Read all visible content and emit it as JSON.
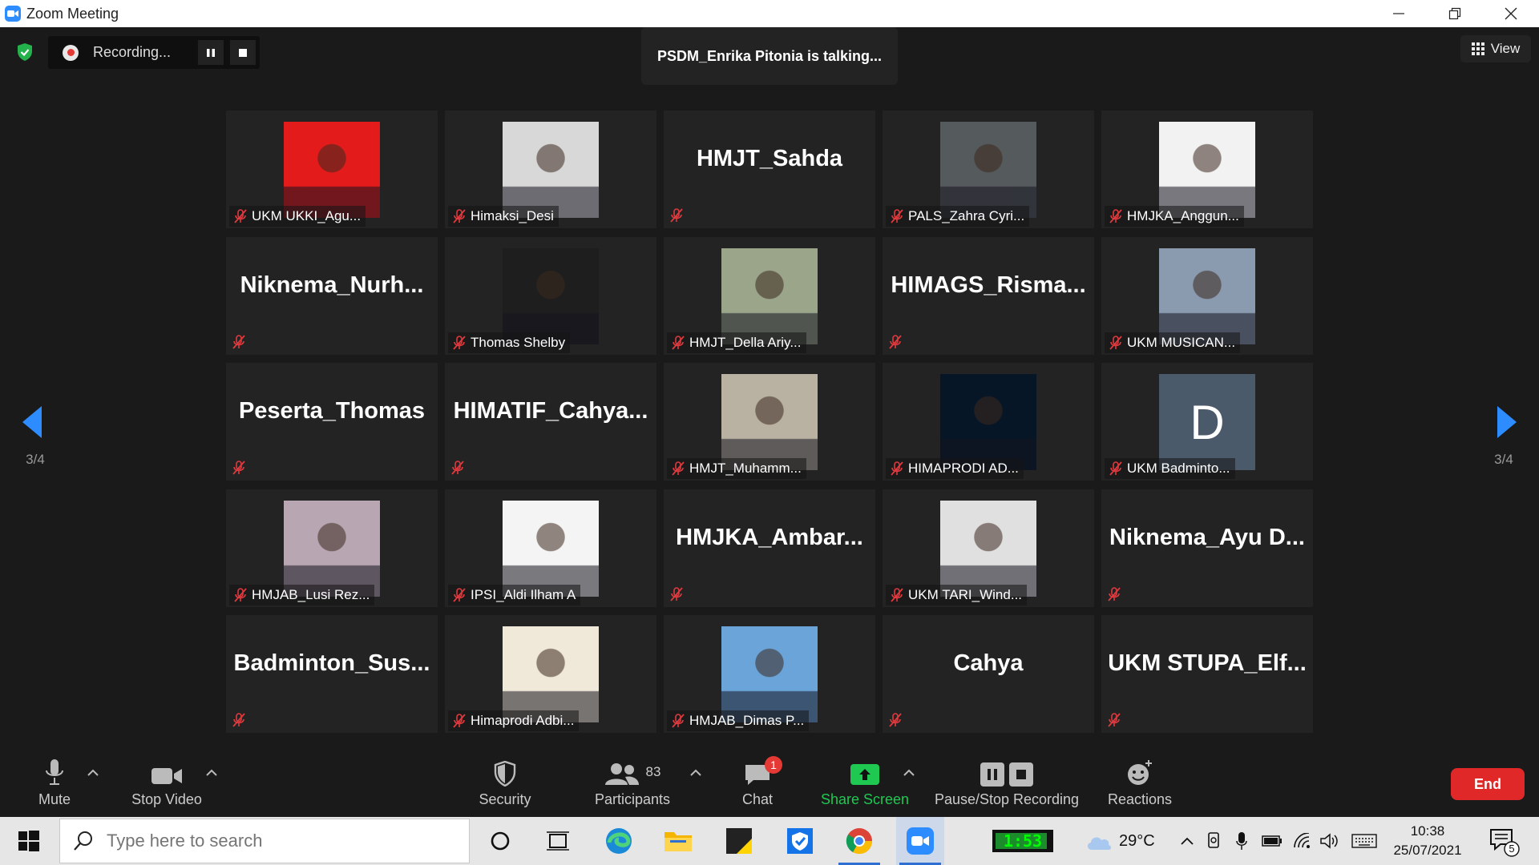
{
  "window": {
    "title": "Zoom Meeting"
  },
  "recording": {
    "status_label": "Recording..."
  },
  "talking_banner": "PSDM_Enrika Pitonia is talking...",
  "view_button": "View",
  "pagination": {
    "left_label": "3/4",
    "right_label": "3/4"
  },
  "participants": [
    {
      "label": "UKM UKKI_Agu...",
      "photo": "photo-man-red-bg",
      "bg": "#e31b1b"
    },
    {
      "label": "Himaksi_Desi",
      "photo": "photo-woman-hijab",
      "bg": "#d8d8d8"
    },
    {
      "name_display": "HMJT_Sahda"
    },
    {
      "label": "PALS_Zahra Cyri...",
      "photo": "photo-woman-hijab-car",
      "bg": "#555a5c"
    },
    {
      "label": "HMJKA_Anggun...",
      "photo": "photo-woman-hijab-flower",
      "bg": "#f2f2f2"
    },
    {
      "name_display": "Niknema_Nurh..."
    },
    {
      "label": "Thomas Shelby",
      "photo": "photo-dark-portrait",
      "bg": "#1e1e1e"
    },
    {
      "label": "HMJT_Della Ariy...",
      "photo": "photo-woman-outdoor",
      "bg": "#9aa58a"
    },
    {
      "name_display": "HIMAGS_Risma..."
    },
    {
      "label": "UKM MUSICAN...",
      "photo": "photo-mountain-man",
      "bg": "#8a9bb0"
    },
    {
      "name_display": "Peserta_Thomas"
    },
    {
      "name_display": "HIMATIF_Cahya..."
    },
    {
      "label": "HMJT_Muhamm...",
      "photo": "photo-mecca-kaaba",
      "bg": "#b9b2a2"
    },
    {
      "label": "HIMAPRODI AD...",
      "photo": "photo-dark-navy",
      "bg": "#071626"
    },
    {
      "label": "UKM Badminto...",
      "avatar_letter": "D",
      "bg": "#4a5a6a"
    },
    {
      "label": "HMJAB_Lusi Rez...",
      "photo": "photo-woman-pink-flowers",
      "bg": "#b8a6b2"
    },
    {
      "label": "IPSI_Aldi Ilham A",
      "photo": "photo-man-orange-shirt",
      "bg": "#f4f4f4"
    },
    {
      "name_display": "HMJKA_Ambar..."
    },
    {
      "label": "UKM TARI_Wind...",
      "photo": "photo-woman-blue-blazer",
      "bg": "#e0e0e0"
    },
    {
      "name_display": "Niknema_Ayu D..."
    },
    {
      "name_display": "Badminton_Sus..."
    },
    {
      "label": "Himaprodi Adbi...",
      "photo": "photo-woman-blue-hijab",
      "bg": "#f0e8d8"
    },
    {
      "label": "HMJAB_Dimas P...",
      "photo": "photo-sky-umbrella",
      "bg": "#6aa4d8"
    },
    {
      "name_display": "Cahya"
    },
    {
      "name_display": "UKM STUPA_Elf..."
    }
  ],
  "toolbar": {
    "mute": "Mute",
    "stop_video": "Stop Video",
    "security": "Security",
    "participants": "Participants",
    "participants_count": "83",
    "chat": "Chat",
    "chat_badge": "1",
    "share_screen": "Share Screen",
    "pause_stop_recording": "Pause/Stop Recording",
    "reactions": "Reactions",
    "end": "End"
  },
  "taskbar": {
    "search_placeholder": "Type here to search",
    "battery_time": "1:53",
    "temperature": "29°C",
    "time": "10:38",
    "date": "25/07/2021",
    "notification_count": "5"
  },
  "colors": {
    "accent": "#2d8cff",
    "share_green": "#1ec851",
    "end_red": "#e02828",
    "muted_red": "#e0393e"
  }
}
